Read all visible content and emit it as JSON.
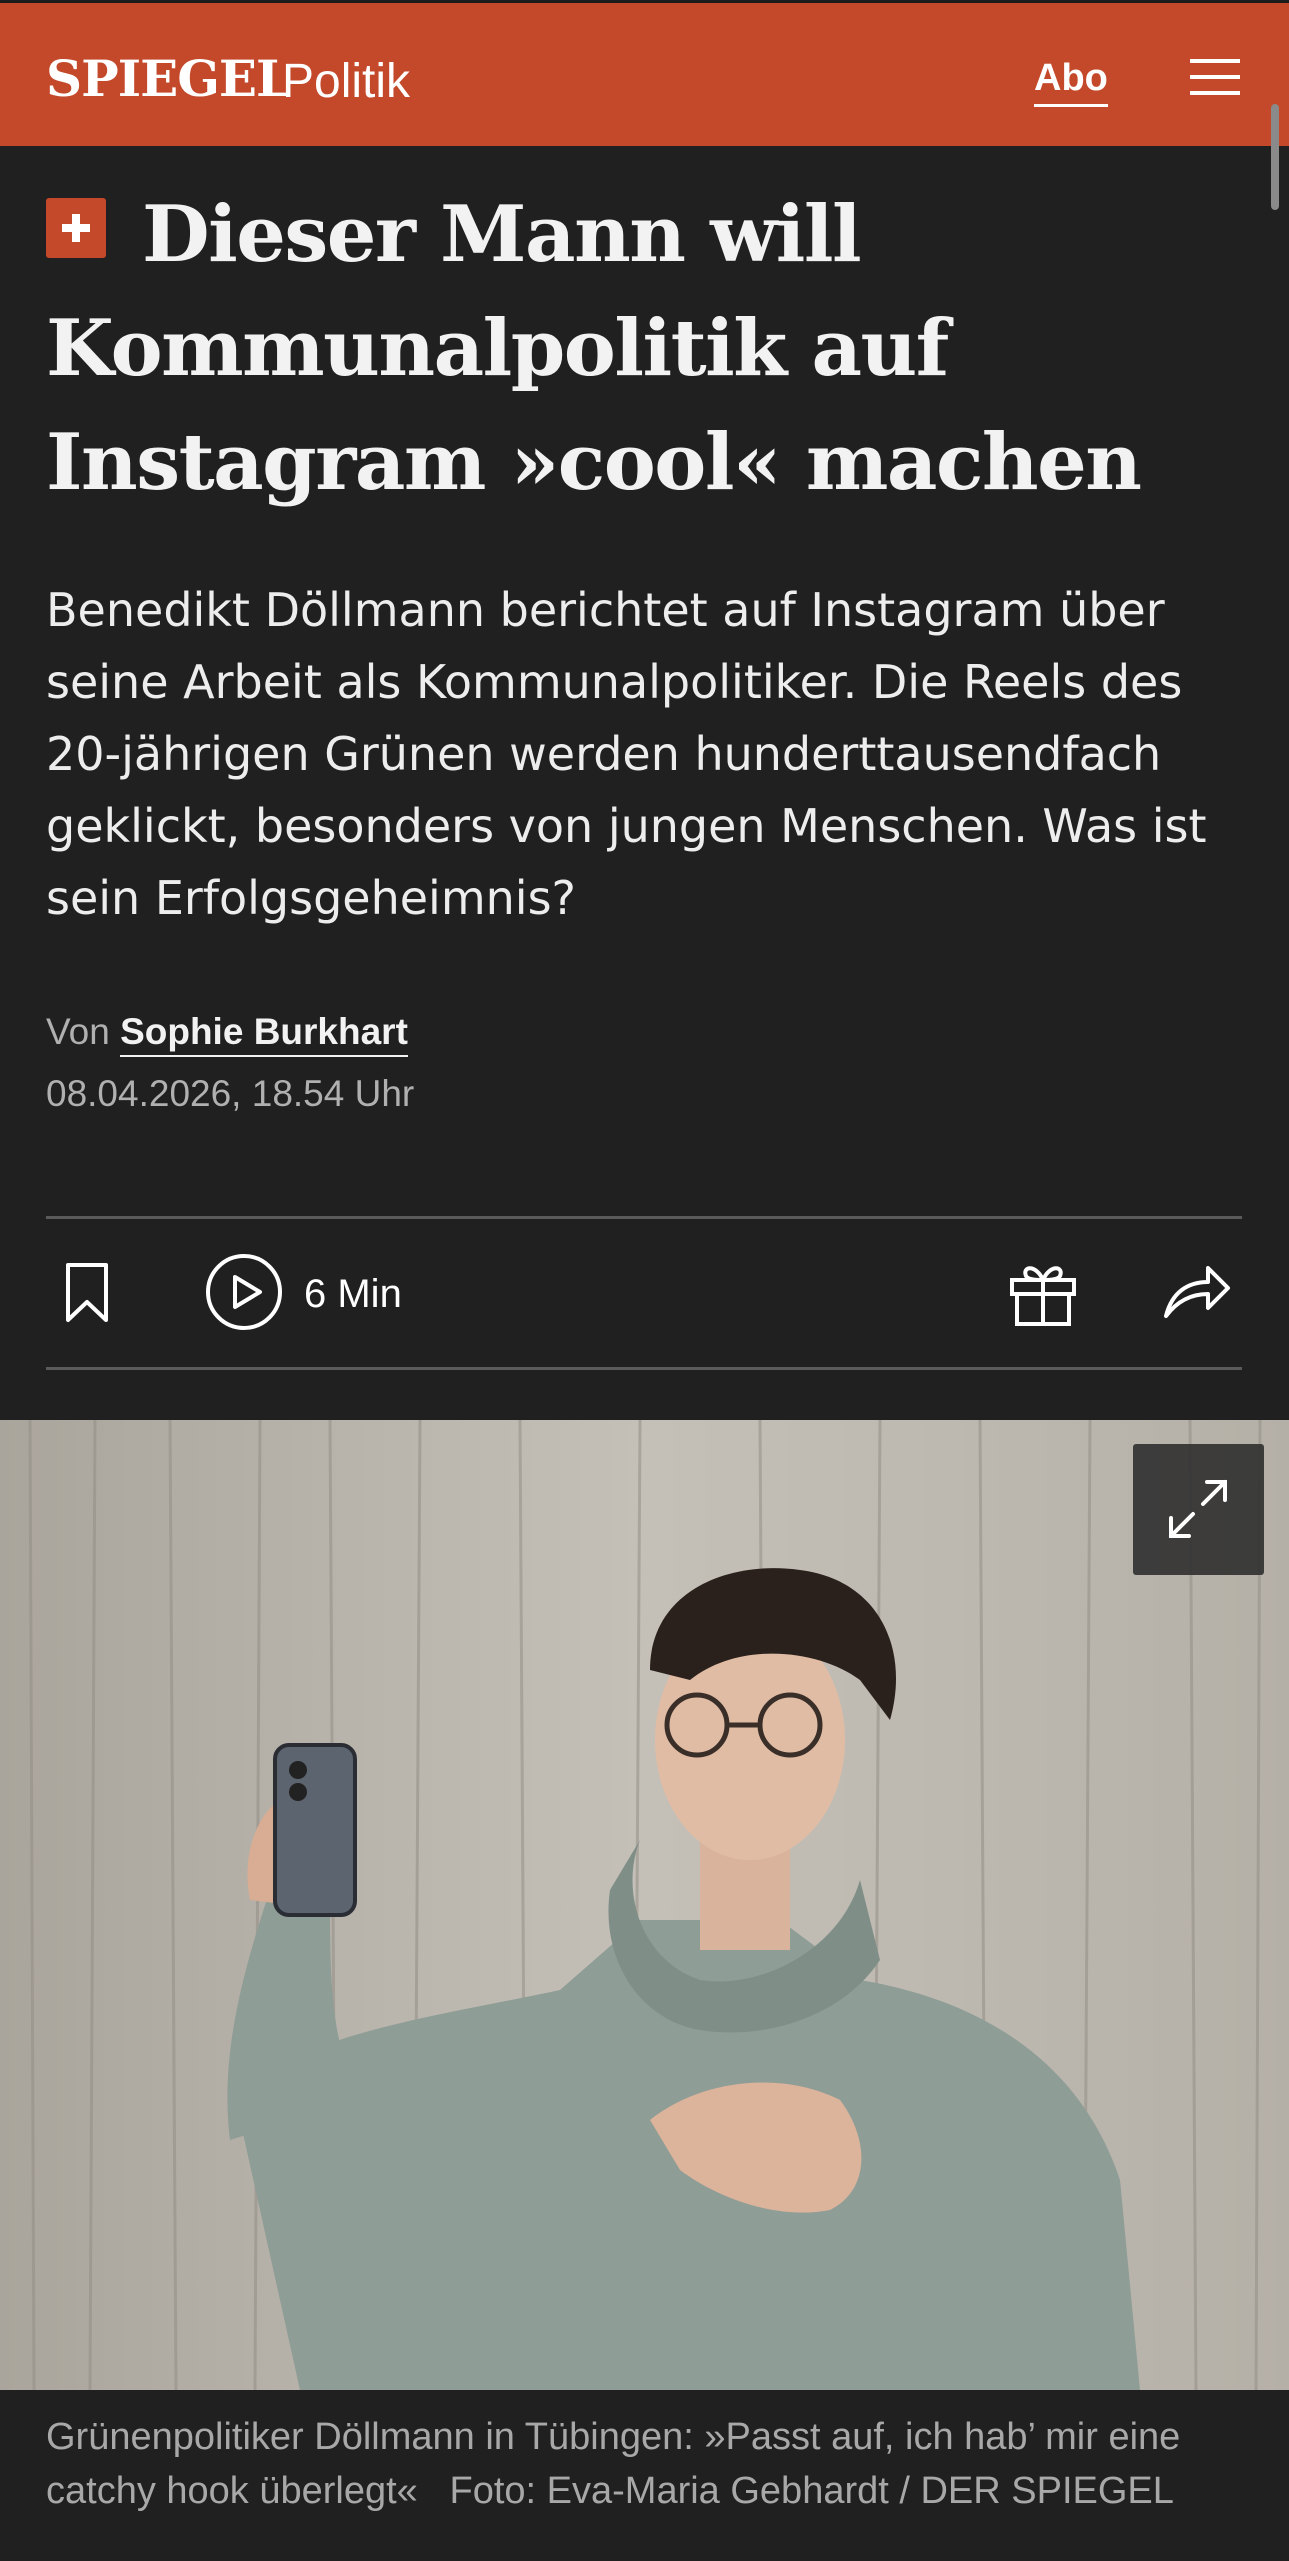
{
  "header": {
    "brand": "SPIEGEL",
    "section": "Politik",
    "abo_label": "Abo",
    "menu_icon": "hamburger-menu-icon",
    "background_color": "#c4482a"
  },
  "article": {
    "plus_icon": "spiegel-plus-icon",
    "headline": "Dieser Mann will Kommunalpolitik auf Instagram »cool« machen",
    "teaser": "Benedikt Döllmann berichtet auf Instagram über seine Arbeit als Kommunalpolitiker. Die Reels des 20-jährigen Grünen werden hunderttausendfach geklickt, besonders von jungen Menschen. Was ist sein Erfolgsgeheimnis?",
    "byline_prefix": "Von",
    "author": "Sophie Burkhart",
    "date": "08.04.2026, 18.54 Uhr"
  },
  "toolbar": {
    "bookmark_icon": "bookmark-icon",
    "play_icon": "play-circle-icon",
    "read_time": "6 Min",
    "gift_icon": "gift-icon",
    "share_icon": "share-arrow-icon"
  },
  "photo": {
    "expand_icon": "expand-icon",
    "caption_text": "Grünenpolitiker Döllmann in Tübingen: »Passt auf, ich hab’ mir eine catchy hook überlegt«",
    "credit": "Foto: Eva-Maria Gebhardt / DER SPIEGEL"
  }
}
